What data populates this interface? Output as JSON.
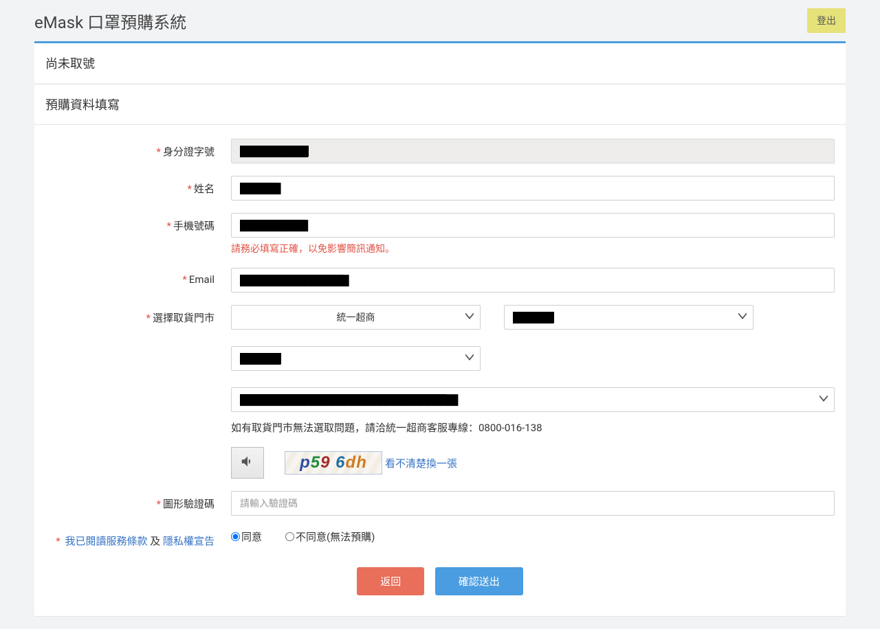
{
  "header": {
    "title": "eMask 口罩預購系統",
    "logout": "登出"
  },
  "status_title": "尚未取號",
  "form_title": "預購資料填寫",
  "labels": {
    "id": "身分證字號",
    "name": "姓名",
    "phone": "手機號碼",
    "email": "Email",
    "store": "選擇取貨門市",
    "captcha": "圖形驗證碼"
  },
  "values": {
    "id": "██████████",
    "name": "██████",
    "phone": "██████████",
    "email": "████████████████",
    "store_chain": "統一超商",
    "store_city": "██████",
    "store_district": "██████",
    "store_branch": "████████████████████████████████"
  },
  "hints": {
    "phone_warn": "請務必填寫正確，以免影響簡訊通知。",
    "store_help": "如有取貨門市無法選取問題，請洽統一超商客服專線：0800-016-138"
  },
  "captcha": {
    "text": "p596dh",
    "refresh": "看不清楚換一張",
    "placeholder": "請輸入驗證碼"
  },
  "terms": {
    "prefix": "我已閱讀服務條款",
    "and": "及",
    "privacy": "隱私權宣告",
    "agree": "同意",
    "disagree": "不同意(無法預購)"
  },
  "buttons": {
    "back": "返回",
    "submit": "確認送出"
  }
}
